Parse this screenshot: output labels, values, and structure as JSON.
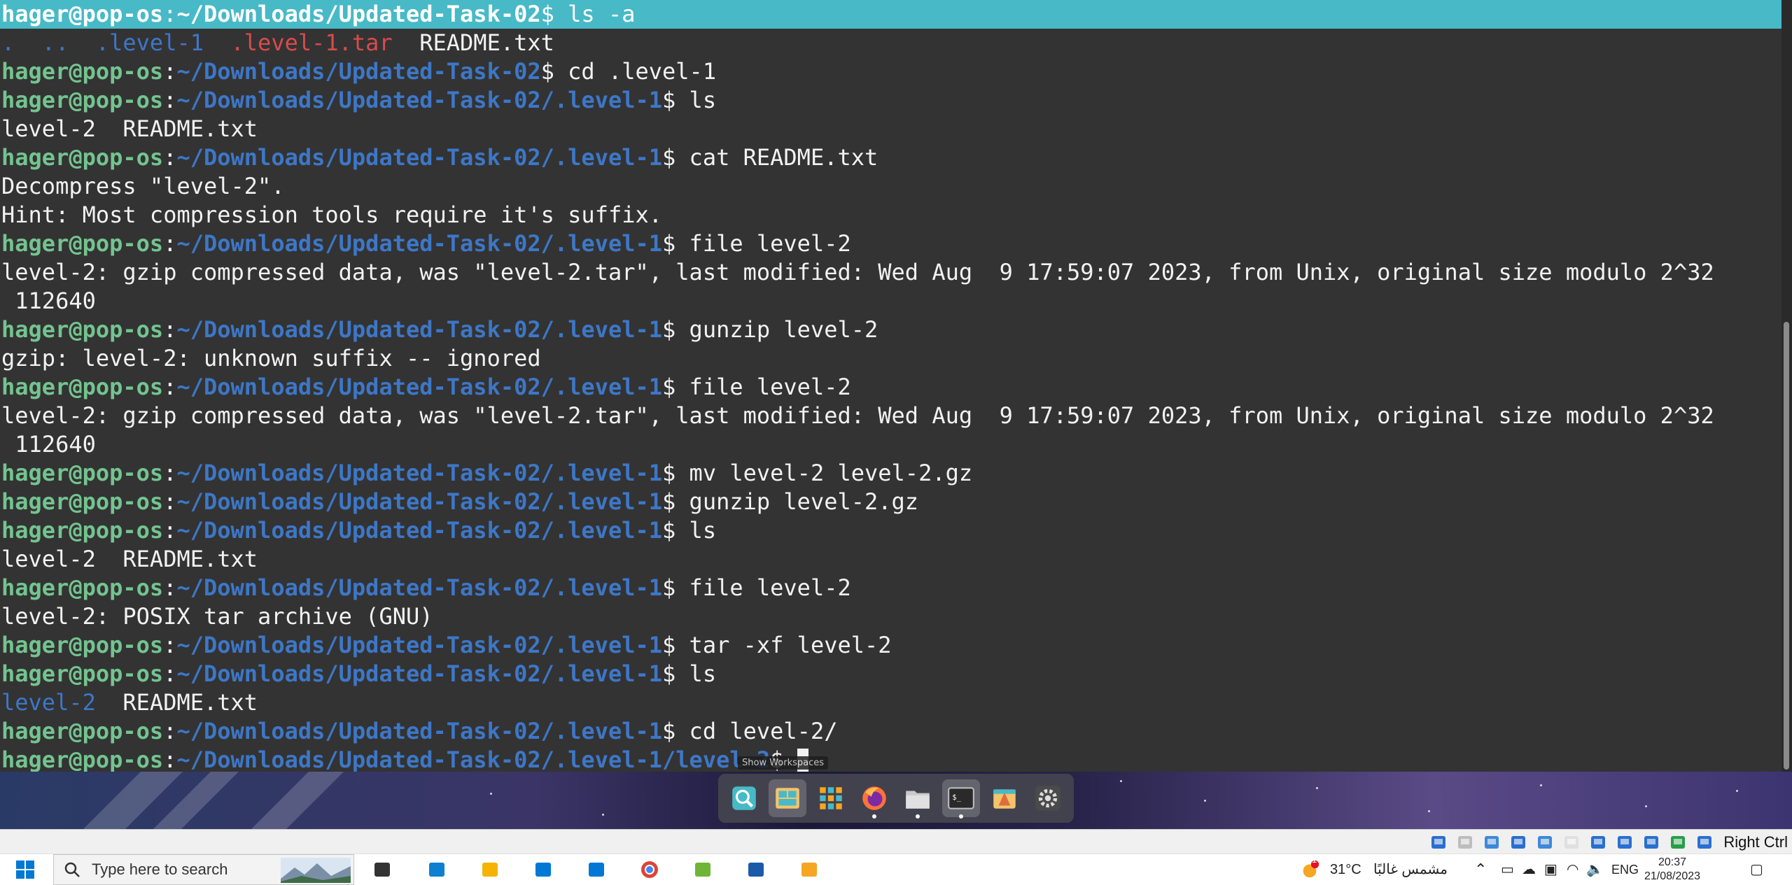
{
  "terminal": {
    "lines": [
      {
        "type": "prompt",
        "user": "hager@pop-os",
        "path": "~/Downloads/Updated-Task-02",
        "cmd": " ls -a",
        "selected": true
      },
      {
        "type": "ls_a",
        "items": [
          ".",
          "..",
          ".level-1",
          ".level-1.tar",
          "README.txt"
        ]
      },
      {
        "type": "prompt",
        "user": "hager@pop-os",
        "path": "~/Downloads/Updated-Task-02",
        "cmd": " cd .level-1"
      },
      {
        "type": "prompt",
        "user": "hager@pop-os",
        "path": "~/Downloads/Updated-Task-02/.level-1",
        "cmd": " ls"
      },
      {
        "type": "out",
        "text": "level-2  README.txt"
      },
      {
        "type": "prompt",
        "user": "hager@pop-os",
        "path": "~/Downloads/Updated-Task-02/.level-1",
        "cmd": " cat README.txt"
      },
      {
        "type": "out",
        "text": "Decompress \"level-2\"."
      },
      {
        "type": "out",
        "text": "Hint: Most compression tools require it's suffix."
      },
      {
        "type": "prompt",
        "user": "hager@pop-os",
        "path": "~/Downloads/Updated-Task-02/.level-1",
        "cmd": " file level-2"
      },
      {
        "type": "out",
        "text": "level-2: gzip compressed data, was \"level-2.tar\", last modified: Wed Aug  9 17:59:07 2023, from Unix, original size modulo 2^32"
      },
      {
        "type": "out",
        "text": " 112640"
      },
      {
        "type": "prompt",
        "user": "hager@pop-os",
        "path": "~/Downloads/Updated-Task-02/.level-1",
        "cmd": " gunzip level-2"
      },
      {
        "type": "out",
        "text": "gzip: level-2: unknown suffix -- ignored"
      },
      {
        "type": "prompt",
        "user": "hager@pop-os",
        "path": "~/Downloads/Updated-Task-02/.level-1",
        "cmd": " file level-2"
      },
      {
        "type": "out",
        "text": "level-2: gzip compressed data, was \"level-2.tar\", last modified: Wed Aug  9 17:59:07 2023, from Unix, original size modulo 2^32"
      },
      {
        "type": "out",
        "text": " 112640"
      },
      {
        "type": "prompt",
        "user": "hager@pop-os",
        "path": "~/Downloads/Updated-Task-02/.level-1",
        "cmd": " mv level-2 level-2.gz"
      },
      {
        "type": "prompt",
        "user": "hager@pop-os",
        "path": "~/Downloads/Updated-Task-02/.level-1",
        "cmd": " gunzip level-2.gz"
      },
      {
        "type": "prompt",
        "user": "hager@pop-os",
        "path": "~/Downloads/Updated-Task-02/.level-1",
        "cmd": " ls"
      },
      {
        "type": "out",
        "text": "level-2  README.txt"
      },
      {
        "type": "prompt",
        "user": "hager@pop-os",
        "path": "~/Downloads/Updated-Task-02/.level-1",
        "cmd": " file level-2"
      },
      {
        "type": "out",
        "text": "level-2: POSIX tar archive (GNU)"
      },
      {
        "type": "prompt",
        "user": "hager@pop-os",
        "path": "~/Downloads/Updated-Task-02/.level-1",
        "cmd": " tar -xf level-2"
      },
      {
        "type": "prompt",
        "user": "hager@pop-os",
        "path": "~/Downloads/Updated-Task-02/.level-1",
        "cmd": " ls"
      },
      {
        "type": "ls_dir",
        "dir": "level-2",
        "rest": "  README.txt"
      },
      {
        "type": "prompt",
        "user": "hager@pop-os",
        "path": "~/Downloads/Updated-Task-02/.level-1",
        "cmd": " cd level-2/"
      },
      {
        "type": "prompt",
        "user": "hager@pop-os",
        "path": "~/Downloads/Updated-Task-02/.level-1/level-2",
        "cmd": " ",
        "cursor": true
      }
    ]
  },
  "tooltip": "Show Workspaces",
  "dock": {
    "items": [
      {
        "name": "search-icon",
        "active": false,
        "running": false
      },
      {
        "name": "workspaces-icon",
        "active": true,
        "running": false
      },
      {
        "name": "app-grid-icon",
        "active": false,
        "running": false
      },
      {
        "name": "firefox-icon",
        "active": false,
        "running": true
      },
      {
        "name": "files-icon",
        "active": false,
        "running": true
      },
      {
        "name": "terminal-icon",
        "active": true,
        "running": true
      },
      {
        "name": "shop-icon",
        "active": false,
        "running": false
      },
      {
        "name": "settings-icon",
        "active": false,
        "running": false
      }
    ]
  },
  "vbox": {
    "host_key": "Right Ctrl",
    "icons": [
      "disk-icon",
      "optical-icon",
      "audio-icon",
      "network-icon",
      "usb-icon",
      "shared-folder-icon",
      "display-icon",
      "recording-icon",
      "vt-x-icon",
      "mouse-integration-icon",
      "download-icon"
    ]
  },
  "taskbar": {
    "search_placeholder": "Type here to search",
    "apps": [
      "task-view-icon",
      "edge-icon",
      "file-explorer-icon",
      "store-icon",
      "mail-icon",
      "chrome-icon",
      "app-icon",
      "virtualbox-icon",
      "app2-icon"
    ],
    "weather_badge": "1",
    "temperature": "31°C",
    "weather_text": "مشمس غالبًا",
    "language": "ENG",
    "time": "20:37",
    "date": "21/08/2023"
  },
  "colors": {
    "terminal_bg": "#333333",
    "user": "#73c48f",
    "path": "#3d77c7",
    "selection": "#48b9c7",
    "tarfile": "#d94b4b"
  }
}
